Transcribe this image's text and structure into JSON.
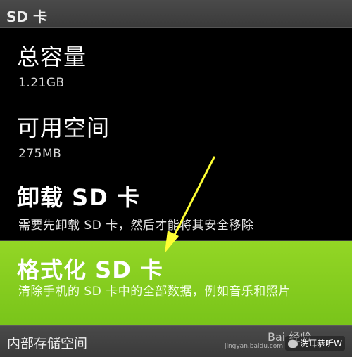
{
  "header": {
    "title": "SD 卡"
  },
  "items": [
    {
      "title": "总容量",
      "summary": "1.21GB"
    },
    {
      "title": "可用空间",
      "summary": "275MB"
    },
    {
      "title": "卸载 SD 卡",
      "summary": "需要先卸载 SD 卡，然后才能将其安全移除"
    },
    {
      "title": "格式化 SD 卡",
      "summary": "清除手机的 SD 卡中的全部数据，例如音乐和照片"
    }
  ],
  "footer": {
    "title": "内部存储空间"
  },
  "watermark": {
    "brand": "Bai 经验",
    "sub": "jingyan.baidu.com",
    "account": "洗耳恭听W"
  },
  "colors": {
    "highlight": "#86cc20",
    "arrow": "#ffff33"
  }
}
